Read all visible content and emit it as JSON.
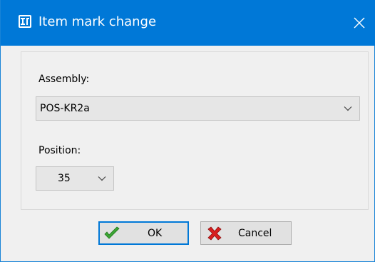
{
  "window": {
    "title": "Item mark change",
    "app_icon": "tekla-dialog-icon",
    "close_icon": "close-icon",
    "titlebar_color": "#0078d7"
  },
  "assembly": {
    "label": "Assembly:",
    "selected": "POS-KR2a"
  },
  "position": {
    "label": "Position:",
    "selected": "35"
  },
  "buttons": {
    "ok_label": "OK",
    "ok_icon": "green-check-icon",
    "cancel_label": "Cancel",
    "cancel_icon": "red-x-icon"
  }
}
